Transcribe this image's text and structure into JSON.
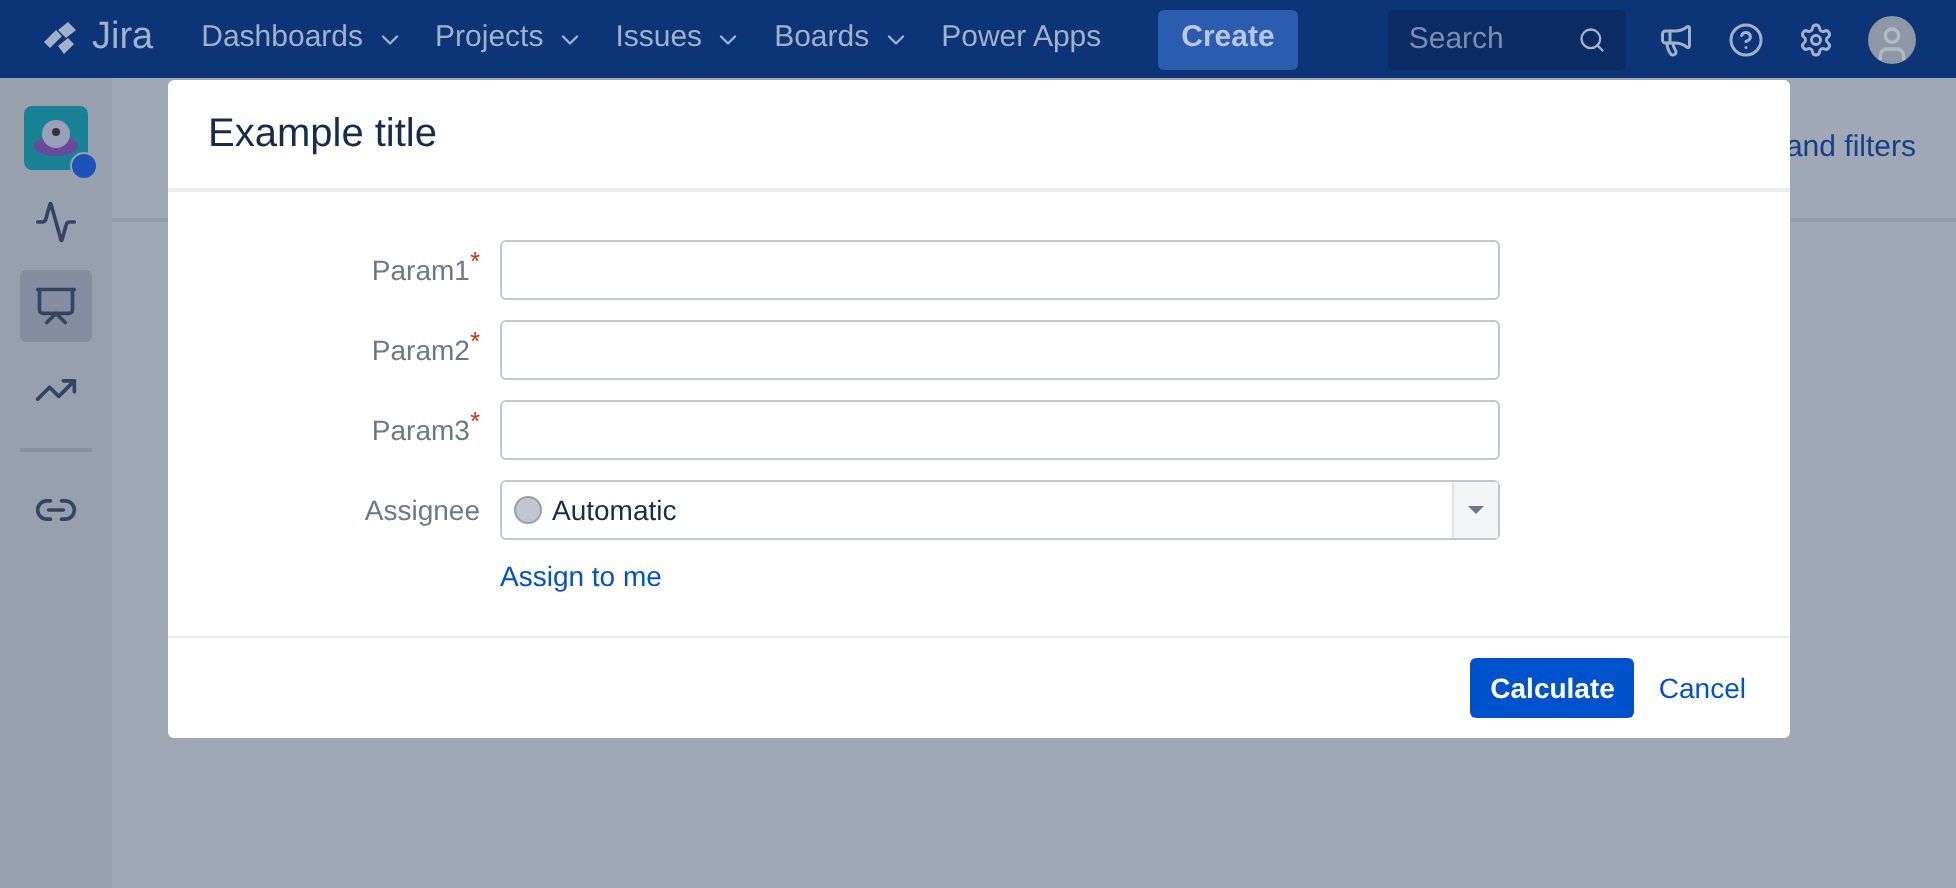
{
  "header": {
    "logo": "Jira",
    "nav": [
      {
        "label": "Dashboards",
        "kind": "menu"
      },
      {
        "label": "Projects",
        "kind": "menu"
      },
      {
        "label": "Issues",
        "kind": "menu"
      },
      {
        "label": "Boards",
        "kind": "menu"
      },
      {
        "label": "Power Apps",
        "kind": "link"
      }
    ],
    "create": "Create",
    "search": {
      "placeholder": "Search"
    }
  },
  "sidebar": {
    "items": [
      {
        "kind": "activity",
        "selected": false
      },
      {
        "kind": "board",
        "selected": true
      },
      {
        "kind": "reports",
        "selected": false
      },
      {
        "kind": "divider"
      },
      {
        "kind": "link",
        "selected": false
      }
    ]
  },
  "page": {
    "filters_link": "and filters"
  },
  "dialog": {
    "title": "Example title",
    "fields": [
      {
        "label": "Param1",
        "required_mark": "*",
        "kind": "text"
      },
      {
        "label": "Param2",
        "required_mark": "*",
        "kind": "text"
      },
      {
        "label": "Param3",
        "required_mark": "*",
        "kind": "text"
      },
      {
        "label": "Assignee",
        "kind": "select",
        "value": "Automatic"
      }
    ],
    "assign_link": "Assign to me",
    "primary": "Calculate",
    "cancel": "Cancel"
  }
}
